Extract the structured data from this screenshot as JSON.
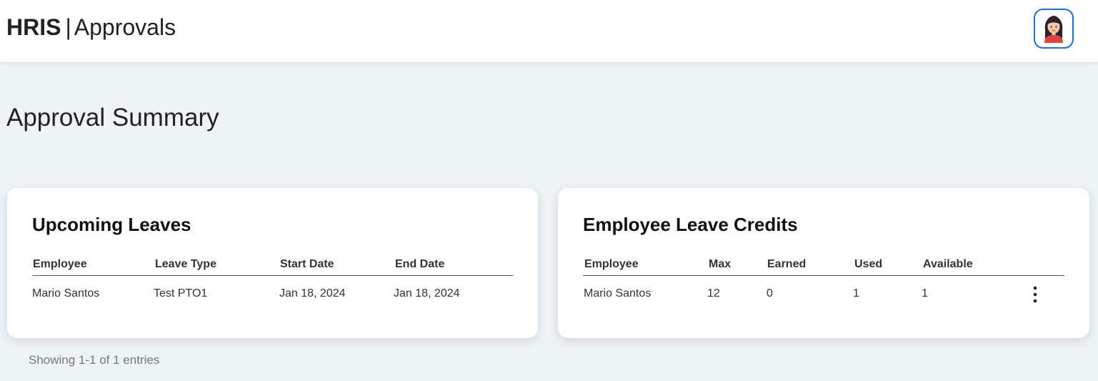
{
  "header": {
    "brand_bold": "HRIS",
    "separator": "|",
    "brand_section": "Approvals",
    "avatar_icon": "user-avatar-icon"
  },
  "page": {
    "title": "Approval Summary"
  },
  "upcoming_leaves": {
    "title": "Upcoming Leaves",
    "columns": [
      "Employee",
      "Leave Type",
      "Start Date",
      "End Date"
    ],
    "rows": [
      [
        "Mario Santos",
        "Test PTO1",
        "Jan 18, 2024",
        "Jan 18, 2024"
      ]
    ],
    "footer": "Showing 1-1 of 1 entries"
  },
  "leave_credits": {
    "title": "Employee Leave Credits",
    "columns": [
      "Employee",
      "Max",
      "Earned",
      "Used",
      "Available"
    ],
    "rows": [
      [
        "Mario Santos",
        "12",
        "0",
        "1",
        "1"
      ]
    ],
    "row_action_icon": "more-vertical-icon"
  },
  "colors": {
    "background": "#eef3f6",
    "card": "#ffffff",
    "avatar_border": "#1e6fd0"
  }
}
